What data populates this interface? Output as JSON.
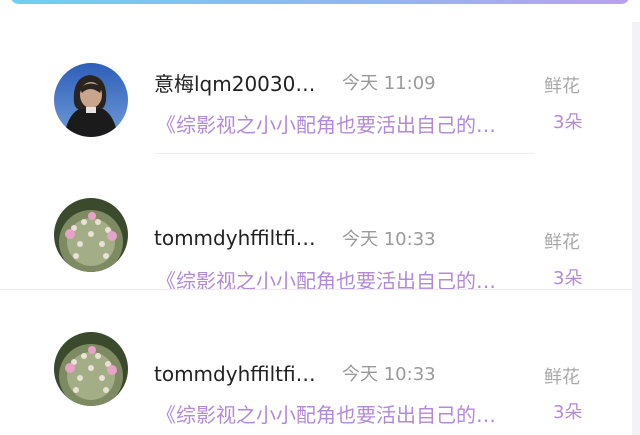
{
  "colors": {
    "accent_purple": "#b38ad8",
    "gradient_start": "#6ed0f0",
    "gradient_end": "#b9a0ee"
  },
  "rows": [
    {
      "avatar": "woman-portrait-avatar",
      "name": "意梅lqm20030…",
      "time": "今天 11:09",
      "gift_label": "鲜花",
      "link_text": "《综影视之小小配角也要活出自己的…",
      "count": "3朵"
    },
    {
      "avatar": "cactus-flower-avatar",
      "name": "tommdyhffiltfiger",
      "time": "今天 10:33",
      "gift_label": "鲜花",
      "link_text": "《综影视之小小配角也要活出自己的…",
      "count": "3朵"
    },
    {
      "avatar": "cactus-flower-avatar",
      "name": "tommdyhffiltfiger",
      "time": "今天 10:33",
      "gift_label": "鲜花",
      "link_text": "《综影视之小小配角也要活出自己的…",
      "count": "3朵"
    }
  ]
}
